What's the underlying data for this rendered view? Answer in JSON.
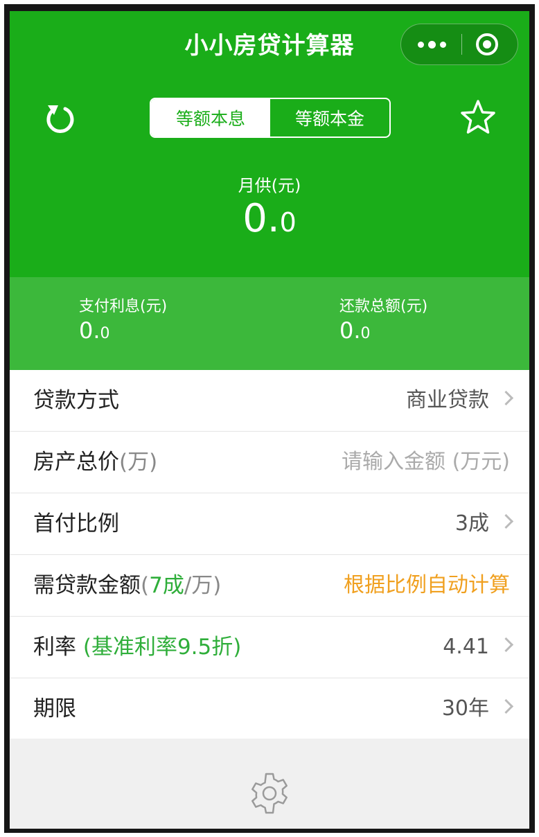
{
  "header": {
    "title": "小小房贷计算器",
    "mode_tabs": [
      {
        "label": "等额本息",
        "active": true
      },
      {
        "label": "等额本金",
        "active": false
      }
    ],
    "icons": {
      "reset": "reset-icon",
      "favorite": "star-icon",
      "more": "more-icon",
      "close": "target-icon"
    }
  },
  "summary": {
    "monthly_label": "月供(元)",
    "monthly_int": "0.",
    "monthly_dec": "0",
    "interest_label": "支付利息(元)",
    "interest_int": "0.",
    "interest_dec": "0",
    "total_label": "还款总额(元)",
    "total_int": "0.",
    "total_dec": "0"
  },
  "form": {
    "loan_type": {
      "label": "贷款方式",
      "value": "商业贷款"
    },
    "price": {
      "label": "房产总价",
      "unit": "(万)",
      "placeholder": "请输入金额 (万元)"
    },
    "down_payment": {
      "label": "首付比例",
      "value": "3成"
    },
    "loan_amount": {
      "label": "需贷款金额",
      "open": "(",
      "ratio": "7成",
      "unit": "/万)",
      "value": "根据比例自动计算"
    },
    "rate": {
      "label": "利率",
      "note": "(基准利率9.5折)",
      "value": "4.41"
    },
    "term": {
      "label": "期限",
      "value": "30年"
    }
  },
  "colors": {
    "primary": "#1aad19",
    "stats_bg": "#3cb83b",
    "accent_orange": "#f0a020",
    "note_green": "#2fae3a"
  },
  "footer": {
    "icon": "gear-icon"
  }
}
